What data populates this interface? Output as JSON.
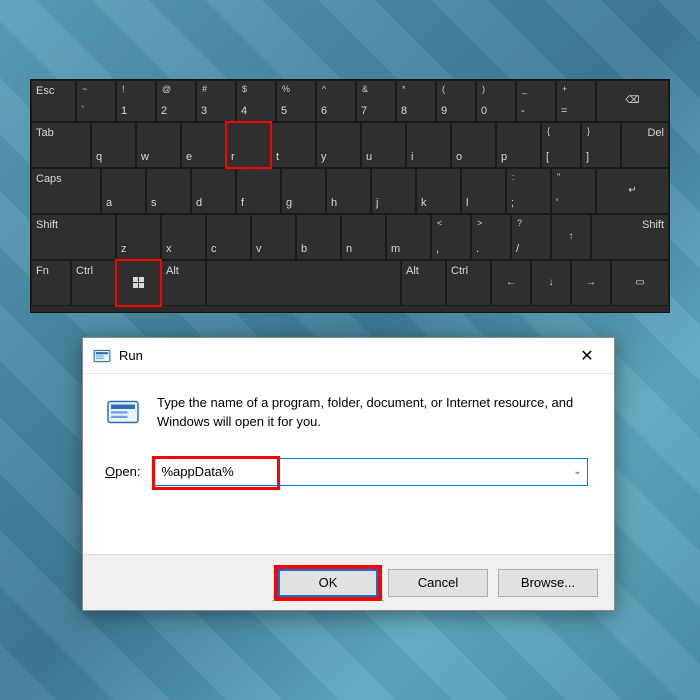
{
  "keyboard": {
    "row1": {
      "k0": "Esc",
      "k1": {
        "top": "~",
        "main": "`"
      },
      "k2": {
        "top": "!",
        "main": "1"
      },
      "k3": {
        "top": "@",
        "main": "2"
      },
      "k4": {
        "top": "#",
        "main": "3"
      },
      "k5": {
        "top": "$",
        "main": "4"
      },
      "k6": {
        "top": "%",
        "main": "5"
      },
      "k7": {
        "top": "^",
        "main": "6"
      },
      "k8": {
        "top": "&",
        "main": "7"
      },
      "k9": {
        "top": "*",
        "main": "8"
      },
      "k10": {
        "top": "(",
        "main": "9"
      },
      "k11": {
        "top": ")",
        "main": "0"
      },
      "k12": {
        "top": "_",
        "main": "-"
      },
      "k13": {
        "top": "+",
        "main": "="
      },
      "bksp_icon": "⌫"
    },
    "row2": {
      "tab": "Tab",
      "q": "q",
      "w": "w",
      "e": "e",
      "r": "r",
      "t": "t",
      "y": "y",
      "u": "u",
      "i": "i",
      "o": "o",
      "p": "p",
      "br1": {
        "top": "{",
        "main": "["
      },
      "br2": {
        "top": "}",
        "main": "]"
      },
      "del": "Del"
    },
    "row3": {
      "caps": "Caps",
      "a": "a",
      "s": "s",
      "d": "d",
      "f": "f",
      "g": "g",
      "h": "h",
      "j": "j",
      "k": "k",
      "l": "l",
      "semi": {
        "top": ":",
        "main": ";"
      },
      "quote": {
        "top": "\"",
        "main": "'"
      },
      "enter": "↵"
    },
    "row4": {
      "lshift": "Shift",
      "z": "z",
      "x": "x",
      "c": "c",
      "v": "v",
      "b": "b",
      "n": "n",
      "m": "m",
      "comma": {
        "top": "<",
        "main": ","
      },
      "period": {
        "top": ">",
        "main": "."
      },
      "slash": {
        "top": "?",
        "main": "/"
      },
      "up": "↑",
      "rshift": "Shift"
    },
    "row5": {
      "fn": "Fn",
      "lctrl": "Ctrl",
      "alt": "Alt",
      "ralt": "Alt",
      "rctrl": "Ctrl",
      "left": "←",
      "down": "↓",
      "right": "→",
      "menu": "▭"
    }
  },
  "run": {
    "title": "Run",
    "description": "Type the name of a program, folder, document, or Internet resource, and Windows will open it for you.",
    "open_label_char": "O",
    "open_label_rest": "pen:",
    "input_value": "%appData%",
    "buttons": {
      "ok": "OK",
      "cancel": "Cancel",
      "browse": "Browse..."
    }
  }
}
